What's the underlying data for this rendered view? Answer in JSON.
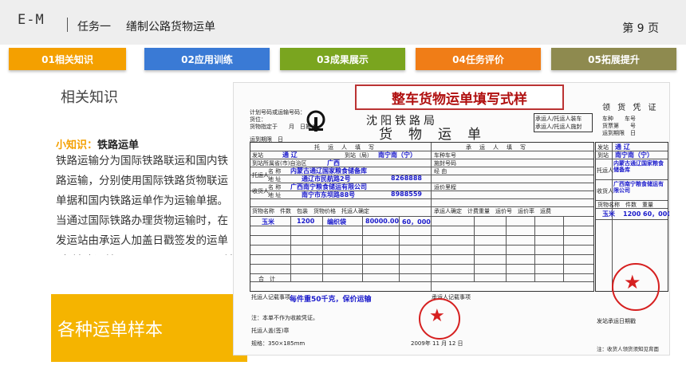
{
  "header": {
    "logo": "E-M",
    "task_label": "任务一",
    "task_title": "缮制公路货物运单",
    "page_number": "第 9 页"
  },
  "tabs": [
    {
      "label": "01相关知识",
      "color": "#f4a000"
    },
    {
      "label": "02应用训练",
      "color": "#3a7ad5"
    },
    {
      "label": "03成果展示",
      "color": "#7aa51f"
    },
    {
      "label": "04任务评价",
      "color": "#f07d17"
    },
    {
      "label": "05拓展提升",
      "color": "#8e8a4f"
    }
  ],
  "section_title": "相关知识",
  "tip_keyword": "小知识：",
  "tip_title": "铁路运单",
  "body_text": "铁路运输分为国际铁路联运和国内铁路运输，分别使用国际铁路货物联运单据和国内铁路运单作为运输单据。当通过国际铁路办理货物运输时，在发运站由承运人加盖日戳签发的运单叫“铁路运单”(Railway Waybill)。铁路运单是由铁路运输承运人签发的货运单据，是收、发货人同铁路之间的运输契约。",
  "banner_text": "各种运单样本",
  "document": {
    "title": "整车货物运单填写式样",
    "railway_name": "沈阳铁路局",
    "waybill_word": "货物运单",
    "right_header": "领 货 凭 证",
    "ship_from": "通 辽",
    "ship_to": "南宁南（宁）",
    "shipper_name": "内蒙古通辽国家粮食储备库",
    "shipper_address": "通辽市民航路2号",
    "shipper_phone": "8268888",
    "receiver_name": "广西南宁粮食储运有限公司",
    "receiver_address": "南宁市东坝路88号",
    "receiver_phone": "8988559",
    "goods": "玉米",
    "pieces": "1200",
    "packaging": "编织袋",
    "goods_value": "80000.00",
    "weight": "60，000",
    "remark": "每件重50千克，保价运输",
    "date": "2009年 11 月 12 日",
    "spec": "规格：350×185mm",
    "note": "注：本单不作为收款凭证。",
    "side_weight": "1200 60，000",
    "side_footer": "注：收货人领货须知见背面"
  }
}
